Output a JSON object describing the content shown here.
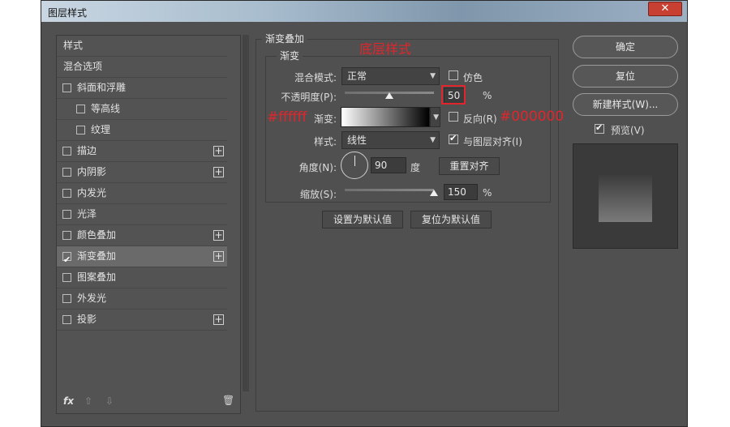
{
  "window": {
    "title": "图层样式",
    "close_glyph": "✕"
  },
  "left_panel": {
    "items": [
      {
        "label": "样式",
        "checkbox": false,
        "checked": false,
        "plus": false,
        "indent": 0
      },
      {
        "label": "混合选项",
        "checkbox": false,
        "checked": false,
        "plus": false,
        "indent": 0
      },
      {
        "label": "斜面和浮雕",
        "checkbox": true,
        "checked": false,
        "plus": false,
        "indent": 0
      },
      {
        "label": "等高线",
        "checkbox": true,
        "checked": false,
        "plus": false,
        "indent": 1
      },
      {
        "label": "纹理",
        "checkbox": true,
        "checked": false,
        "plus": false,
        "indent": 1
      },
      {
        "label": "描边",
        "checkbox": true,
        "checked": false,
        "plus": true,
        "indent": 0
      },
      {
        "label": "内阴影",
        "checkbox": true,
        "checked": false,
        "plus": true,
        "indent": 0
      },
      {
        "label": "内发光",
        "checkbox": true,
        "checked": false,
        "plus": false,
        "indent": 0
      },
      {
        "label": "光泽",
        "checkbox": true,
        "checked": false,
        "plus": false,
        "indent": 0
      },
      {
        "label": "颜色叠加",
        "checkbox": true,
        "checked": false,
        "plus": true,
        "indent": 0
      },
      {
        "label": "渐变叠加",
        "checkbox": true,
        "checked": true,
        "plus": true,
        "indent": 0,
        "selected": true
      },
      {
        "label": "图案叠加",
        "checkbox": true,
        "checked": false,
        "plus": false,
        "indent": 0
      },
      {
        "label": "外发光",
        "checkbox": true,
        "checked": false,
        "plus": false,
        "indent": 0
      },
      {
        "label": "投影",
        "checkbox": true,
        "checked": false,
        "plus": true,
        "indent": 0
      }
    ],
    "footer": {
      "fx": "fx",
      "up": "⇧",
      "down": "⇩",
      "trash": "🗑"
    }
  },
  "gradient_overlay": {
    "section_title": "渐变叠加",
    "subsection_title": "渐变",
    "blend_mode_label": "混合模式:",
    "blend_mode_value": "正常",
    "dither_label": "仿色",
    "dither_checked": false,
    "opacity_label": "不透明度(P):",
    "opacity_value": "50",
    "opacity_unit": "%",
    "opacity_level": 0.5,
    "gradient_label": "渐变:",
    "reverse_label": "反向(R)",
    "reverse_checked": false,
    "style_label": "样式:",
    "style_value": "线性",
    "align_label": "与图层对齐(I)",
    "align_checked": true,
    "angle_label": "角度(N):",
    "angle_value": "90",
    "angle_unit": "度",
    "reset_align_label": "重置对齐",
    "scale_label": "缩放(S):",
    "scale_value": "150",
    "scale_unit": "%",
    "scale_level": 1.0,
    "set_default_label": "设置为默认值",
    "reset_default_label": "复位为默认值"
  },
  "annotations": {
    "layer_caption": "底层样式",
    "left_color": "#ffffff",
    "right_color": "#000000",
    "red": "#e0262c"
  },
  "right_panel": {
    "ok_label": "确定",
    "reset_label": "复位",
    "new_style_label": "新建样式(W)...",
    "preview_label": "预览(V)",
    "preview_checked": true
  }
}
